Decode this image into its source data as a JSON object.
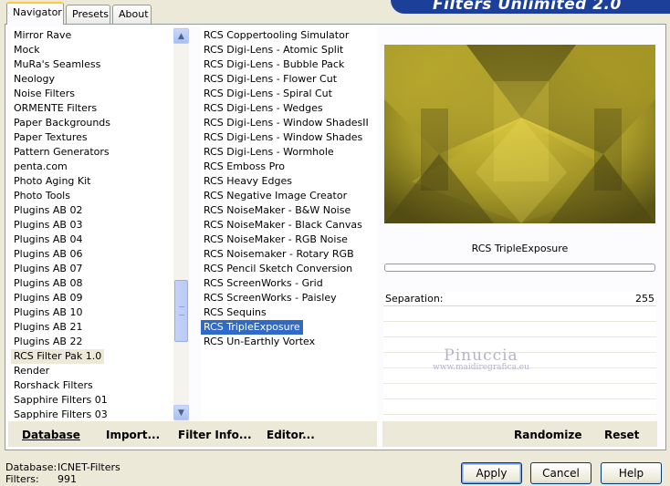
{
  "tabs": [
    {
      "label": "Navigator"
    },
    {
      "label": "Presets"
    },
    {
      "label": "About"
    }
  ],
  "banner": {
    "title": "Filters Unlimited 2.0"
  },
  "categories": [
    "Mirror Rave",
    "Mock",
    "MuRa's Seamless",
    "Neology",
    "Noise Filters",
    "ORMENTE Filters",
    "Paper Backgrounds",
    "Paper Textures",
    "Pattern Generators",
    "penta.com",
    "Photo Aging Kit",
    "Photo Tools",
    "Plugins AB 02",
    "Plugins AB 03",
    "Plugins AB 04",
    "Plugins AB 06",
    "Plugins AB 07",
    "Plugins AB 08",
    "Plugins AB 09",
    "Plugins AB 10",
    "Plugins AB 21",
    "Plugins AB 22",
    "RCS Filter Pak 1.0",
    "Render",
    "Rorshack Filters",
    "Sapphire Filters 01",
    "Sapphire Filters 03"
  ],
  "selected_category": "RCS Filter Pak 1.0",
  "filters": [
    "RCS Coppertooling Simulator",
    "RCS Digi-Lens - Atomic Split",
    "RCS Digi-Lens - Bubble Pack",
    "RCS Digi-Lens - Flower Cut",
    "RCS Digi-Lens - Spiral Cut",
    "RCS Digi-Lens - Wedges",
    "RCS Digi-Lens - Window ShadesII",
    "RCS Digi-Lens - Window Shades",
    "RCS Digi-Lens - Wormhole",
    "RCS Emboss Pro",
    "RCS Heavy Edges",
    "RCS Negative Image Creator",
    "RCS NoiseMaker - B&W Noise",
    "RCS NoiseMaker - Black Canvas",
    "RCS NoiseMaker - RGB Noise",
    "RCS Noisemaker - Rotary RGB",
    "RCS Pencil Sketch Conversion",
    "RCS ScreenWorks - Grid",
    "RCS ScreenWorks - Paisley",
    "RCS Sequins",
    "RCS TripleExposure",
    "RCS Un-Earthly Vortex"
  ],
  "selected_filter": "RCS TripleExposure",
  "preview": {
    "filter_name": "RCS TripleExposure",
    "progress": 0
  },
  "parameters": [
    {
      "label": "Separation:",
      "value": "255"
    }
  ],
  "watermark": {
    "line1": "Pinuccia",
    "line2": "www.maidiregrafica.eu"
  },
  "left_buttons": {
    "database": "Database",
    "import": "Import...",
    "filter_info": "Filter Info...",
    "editor": "Editor..."
  },
  "right_buttons": {
    "randomize": "Randomize",
    "reset": "Reset"
  },
  "status": {
    "database_label": "Database:",
    "database_value": "ICNET-Filters",
    "filters_label": "Filters:",
    "filters_value": "991"
  },
  "dialog_buttons": {
    "apply": "Apply",
    "cancel": "Cancel",
    "help": "Help"
  },
  "colors": {
    "selection": "#316ac5",
    "banner": "#1c3f9a",
    "preview_gold": "#c8b420"
  }
}
